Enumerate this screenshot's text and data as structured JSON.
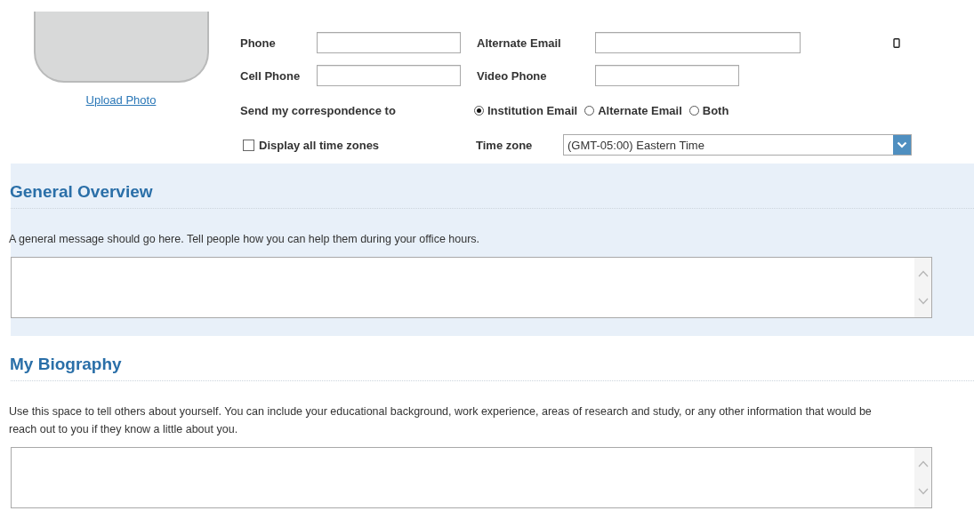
{
  "photo": {
    "link": "Upload Photo"
  },
  "contact_rows": [
    {
      "fields": [
        {
          "label": "Phone"
        },
        {
          "label": "Alternate Email"
        }
      ],
      "mobile_icon": true
    },
    {
      "fields": [
        {
          "label": "Cell Phone"
        },
        {
          "label": "Video Phone"
        }
      ],
      "mobile_icon": false
    }
  ],
  "correspondence": {
    "label": "Send my correspondence to",
    "options": [
      {
        "label": "Institution Email",
        "selected": true
      },
      {
        "label": "Alternate Email",
        "selected": false
      },
      {
        "label": "Both",
        "selected": false
      }
    ]
  },
  "display_all_time_zones": {
    "label": "Display all time zones",
    "checked": false
  },
  "time_zone": {
    "label": "Time zone",
    "value": "(GMT-05:00) Eastern Time"
  },
  "sections": [
    {
      "title": "General Overview",
      "highlighted": true,
      "lines": [
        "A general message should go here. Tell people how you can help them during your office hours."
      ]
    },
    {
      "title": "My Biography",
      "highlighted": false,
      "lines": [
        "Use this space to tell others about yourself. You can include your educational background, work experience, areas of research and study, or any other information that would be",
        "reach out to you if they know a little about you."
      ]
    }
  ]
}
